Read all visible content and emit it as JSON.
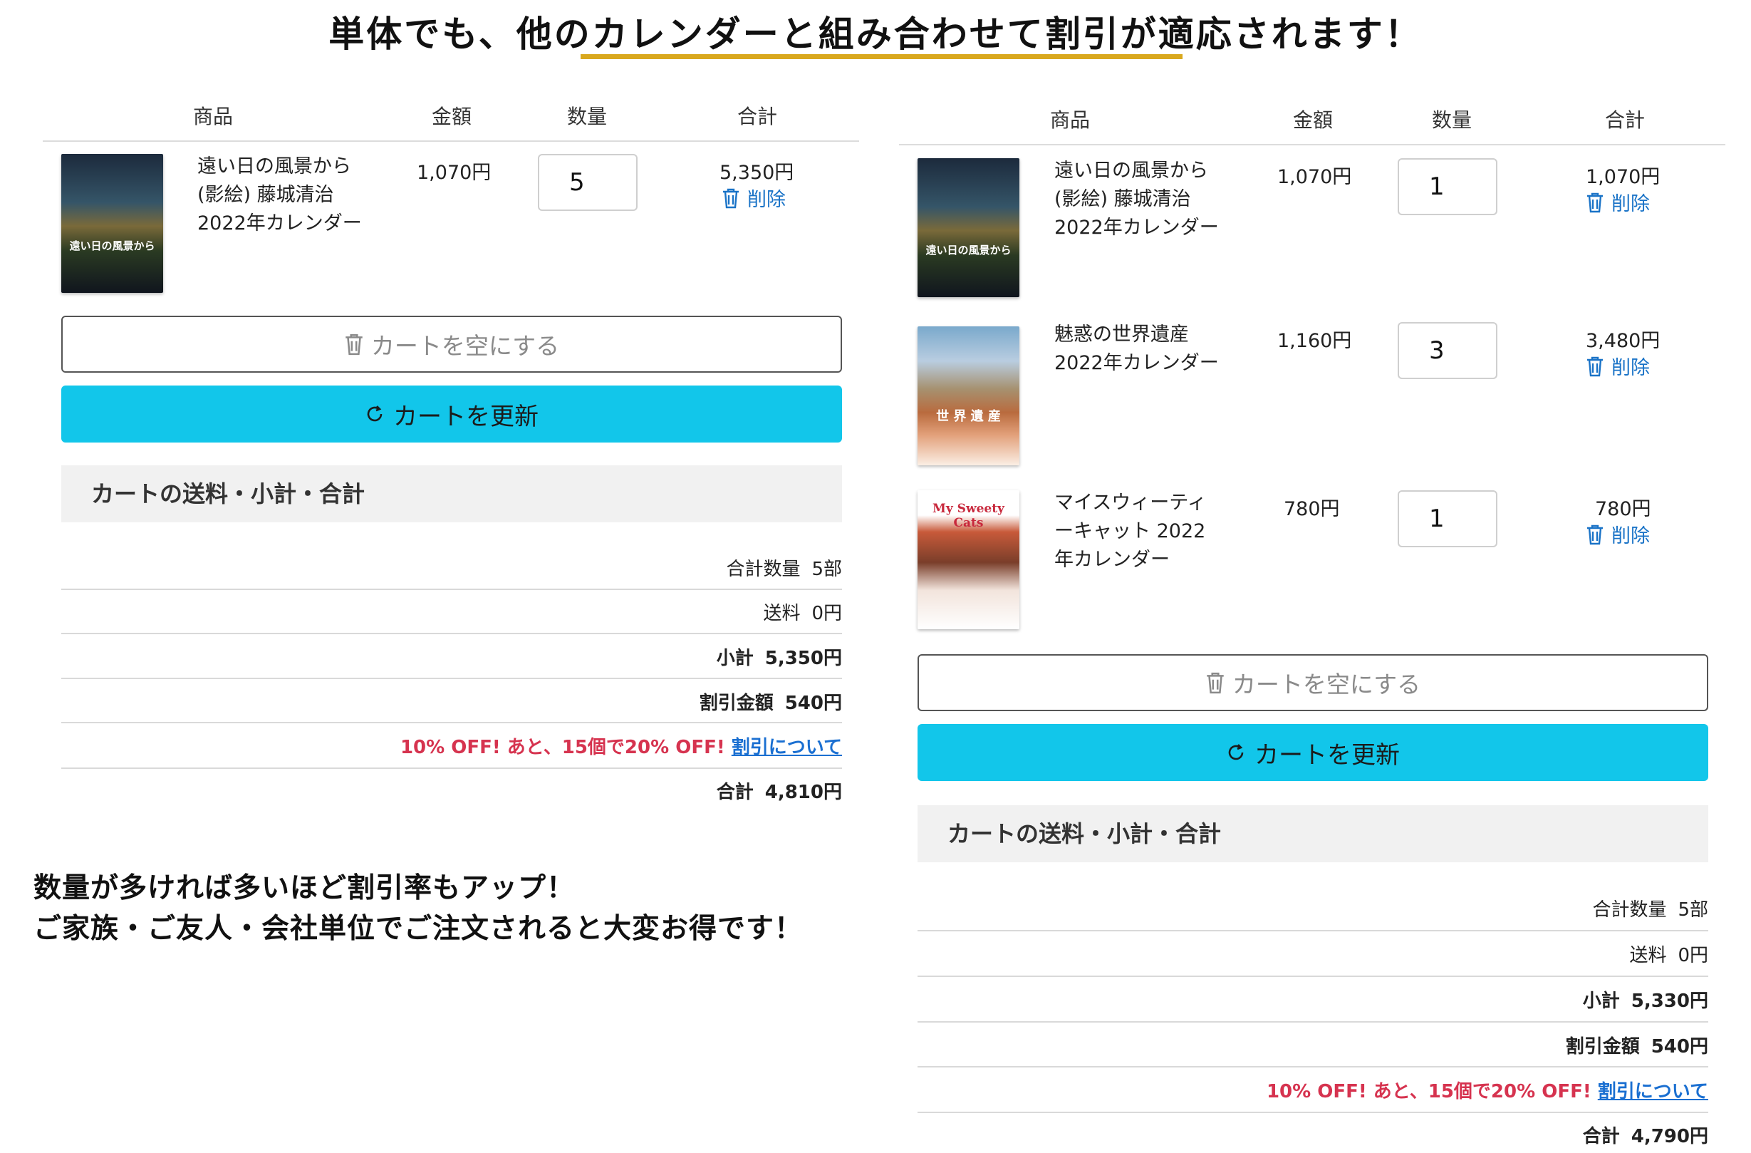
{
  "headline": "単体でも、他のカレンダーと組み合わせて割引が適応されます！",
  "colors": {
    "accent_rule": "#d9a81e",
    "update_button": "#12c6ea",
    "promo_red": "#d6334f",
    "link_blue": "#1a73c7"
  },
  "left": {
    "headers": {
      "product": "商品",
      "price": "金額",
      "qty": "数量",
      "total": "合計"
    },
    "items": [
      {
        "name_lines": [
          "遠い日の風景から",
          "(影絵) 藤城清治",
          "2022年カレンダー"
        ],
        "price": "1,070円",
        "qty": "5",
        "subtotal": "5,350円",
        "delete": "削除",
        "cover_title": "遠い日の風景から"
      }
    ],
    "empty_cart": "カートを空にする",
    "update_cart": "カートを更新",
    "totals_title": "カートの送料・小計・合計",
    "totals": {
      "qty_label": "合計数量",
      "qty_value": "5部",
      "shipping_label": "送料",
      "shipping_value": "0円",
      "subtotal_label": "小計",
      "subtotal_value": "5,350円",
      "discount_label": "割引金額",
      "discount_value": "540円",
      "promo_text": "10% OFF! あと、15個で20% OFF!",
      "promo_link": "割引について",
      "total_label": "合計",
      "total_value": "4,810円"
    }
  },
  "note": [
    "数量が多ければ多いほど割引率もアップ！",
    "ご家族・ご友人・会社単位でご注文されると大変お得です！"
  ],
  "right": {
    "headers": {
      "product": "商品",
      "price": "金額",
      "qty": "数量",
      "total": "合計"
    },
    "items": [
      {
        "name_lines": [
          "遠い日の風景から",
          "(影絵) 藤城清治",
          "2022年カレンダー"
        ],
        "price": "1,070円",
        "qty": "1",
        "subtotal": "1,070円",
        "delete": "削除",
        "cover_title": "遠い日の風景から"
      },
      {
        "name_lines": [
          "魅惑の世界遺産",
          "2022年カレンダー"
        ],
        "price": "1,160円",
        "qty": "3",
        "subtotal": "3,480円",
        "delete": "削除",
        "cover_title": "世 界 遺 産"
      },
      {
        "name_lines": [
          "マイスウィーティ",
          "ーキャット 2022",
          "年カレンダー"
        ],
        "price": "780円",
        "qty": "1",
        "subtotal": "780円",
        "delete": "削除",
        "cover_title": "My Sweety Cats"
      }
    ],
    "empty_cart": "カートを空にする",
    "update_cart": "カートを更新",
    "totals_title": "カートの送料・小計・合計",
    "totals": {
      "qty_label": "合計数量",
      "qty_value": "5部",
      "shipping_label": "送料",
      "shipping_value": "0円",
      "subtotal_label": "小計",
      "subtotal_value": "5,330円",
      "discount_label": "割引金額",
      "discount_value": "540円",
      "promo_text": "10% OFF! あと、15個で20% OFF!",
      "promo_link": "割引について",
      "total_label": "合計",
      "total_value": "4,790円"
    }
  }
}
